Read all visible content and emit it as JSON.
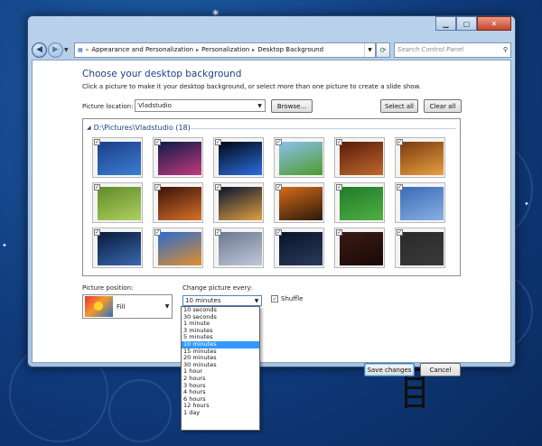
{
  "breadcrumb": [
    "Appearance and Personalization",
    "Personalization",
    "Desktop Background"
  ],
  "search": {
    "placeholder": "Search Control Panel"
  },
  "title": "Choose your desktop background",
  "subtitle": "Click a picture to make it your desktop background, or select more than one picture to create a slide show.",
  "location": {
    "label": "Picture location:",
    "value": "Vladstudio",
    "browse": "Browse...",
    "select_all": "Select all",
    "clear_all": "Clear all"
  },
  "gallery": {
    "group_label": "D:\\Pictures\\Vladstudio (18)",
    "thumbs": [
      {
        "c1": "#1d3d8a",
        "c2": "#3a7fd0"
      },
      {
        "c1": "#0d1b4a",
        "c2": "#c23a7a"
      },
      {
        "c1": "#000814",
        "c2": "#2c6ee0"
      },
      {
        "c1": "#8cc0f0",
        "c2": "#4f9a2c"
      },
      {
        "c1": "#5a1a0a",
        "c2": "#c06a2a"
      },
      {
        "c1": "#7a3a10",
        "c2": "#e8a040"
      },
      {
        "c1": "#5f8a2a",
        "c2": "#b0d060"
      },
      {
        "c1": "#3a1208",
        "c2": "#d8702a"
      },
      {
        "c1": "#081430",
        "c2": "#e0a040"
      },
      {
        "c1": "#d86a1a",
        "c2": "#2a1a0a"
      },
      {
        "c1": "#1f7a2a",
        "c2": "#50b040"
      },
      {
        "c1": "#3a6ab8",
        "c2": "#88b0e0"
      },
      {
        "c1": "#081a3a",
        "c2": "#3a68b0"
      },
      {
        "c1": "#2a6ad0",
        "c2": "#e0902a"
      },
      {
        "c1": "#6a7890",
        "c2": "#c0c8d8"
      },
      {
        "c1": "#0a1428",
        "c2": "#2a3a5a"
      },
      {
        "c1": "#3a1a14",
        "c2": "#1a0a08"
      },
      {
        "c1": "#2a2a2a",
        "c2": "#3a3a3a"
      }
    ]
  },
  "position": {
    "label": "Picture position:",
    "value": "Fill"
  },
  "change": {
    "label": "Change picture every:",
    "value": "10 minutes",
    "shuffle_label": "Shuffle",
    "options": [
      "10 seconds",
      "30 seconds",
      "1 minute",
      "3 minutes",
      "5 minutes",
      "10 minutes",
      "15 minutes",
      "20 minutes",
      "30 minutes",
      "1 hour",
      "2 hours",
      "3 hours",
      "4 hours",
      "6 hours",
      "12 hours",
      "1 day"
    ],
    "selected_index": 5
  },
  "buttons": {
    "save": "Save changes",
    "cancel": "Cancel"
  }
}
